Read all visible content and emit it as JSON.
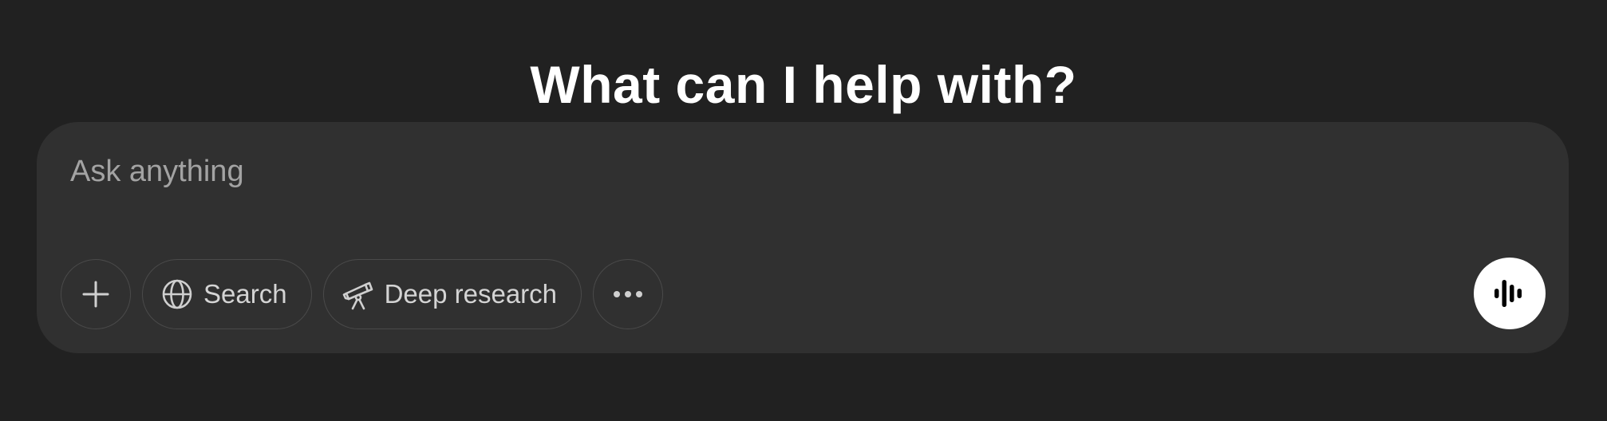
{
  "heading": "What can I help with?",
  "composer": {
    "placeholder": "Ask anything",
    "value": ""
  },
  "toolbar": {
    "add_icon": "plus-icon",
    "search": {
      "label": "Search",
      "icon": "globe-icon"
    },
    "deep_research": {
      "label": "Deep research",
      "icon": "telescope-icon"
    },
    "more_icon": "ellipsis-icon"
  },
  "voice": {
    "icon": "voice-waveform-icon"
  },
  "colors": {
    "background": "#212121",
    "composer": "#303030",
    "pill_border": "#4a4a4a",
    "text_primary": "#ffffff",
    "text_muted": "#a3a3a3",
    "voice_button": "#ffffff"
  }
}
